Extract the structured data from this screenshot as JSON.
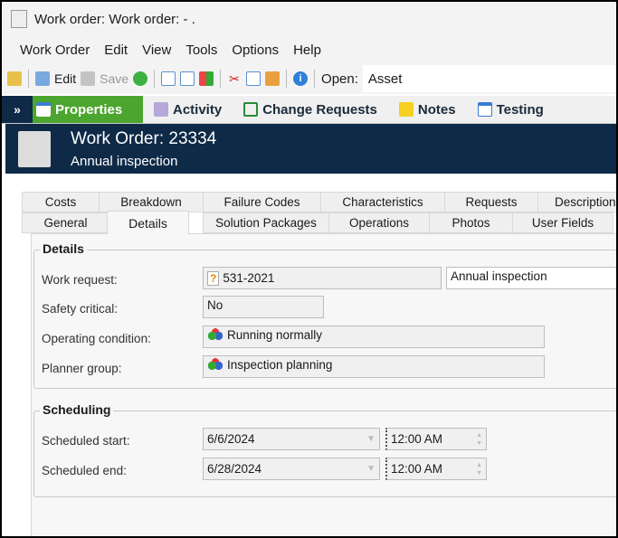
{
  "window": {
    "title": "Work order: Work order:  - ."
  },
  "menu": [
    "Work Order",
    "Edit",
    "View",
    "Tools",
    "Options",
    "Help"
  ],
  "toolbar": {
    "edit": "Edit",
    "save": "Save",
    "open_label": "Open:",
    "open_value": "Asset"
  },
  "nav": [
    "Properties",
    "Activity",
    "Change Requests",
    "Notes",
    "Testing"
  ],
  "header": {
    "title": "Work Order: 23334",
    "subtitle": "Annual inspection"
  },
  "tabs_row1": [
    "Costs",
    "Breakdown",
    "Failure Codes",
    "Characteristics",
    "Requests",
    "Description"
  ],
  "tabs_row2": [
    "General",
    "Details",
    "Solution Packages",
    "Operations",
    "Photos",
    "User Fields"
  ],
  "details": {
    "title": "Details",
    "work_request_label": "Work request:",
    "work_request": "531-2021",
    "work_request_desc": "Annual inspection",
    "safety_label": "Safety critical:",
    "safety": "No",
    "opcond_label": "Operating condition:",
    "opcond": "Running normally",
    "planner_label": "Planner group:",
    "planner": "Inspection planning"
  },
  "scheduling": {
    "title": "Scheduling",
    "start_label": "Scheduled start:",
    "start_date": "6/6/2024",
    "start_time": "12:00 AM",
    "end_label": "Scheduled end:",
    "end_date": "6/28/2024",
    "end_time": "12:00 AM"
  }
}
